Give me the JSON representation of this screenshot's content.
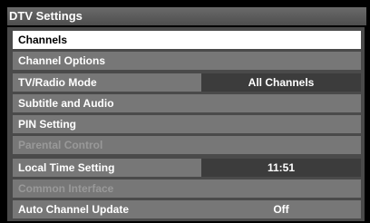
{
  "header": {
    "title": "DTV Settings"
  },
  "menu": {
    "items": [
      {
        "label": "Channels",
        "value": null,
        "state": "selected"
      },
      {
        "label": "Channel Options",
        "value": null,
        "state": "normal"
      },
      {
        "label": "TV/Radio Mode",
        "value": "All Channels",
        "state": "normal"
      },
      {
        "label": "Subtitle and Audio",
        "value": null,
        "state": "normal"
      },
      {
        "label": "PIN Setting",
        "value": null,
        "state": "normal"
      },
      {
        "label": "Parental Control",
        "value": null,
        "state": "disabled"
      },
      {
        "label": "Local Time Setting",
        "value": "11:51",
        "state": "normal"
      },
      {
        "label": "Common Interface",
        "value": null,
        "state": "disabled"
      },
      {
        "label": "Auto Channel Update",
        "value": "Off",
        "state": "normal"
      }
    ]
  },
  "colors": {
    "selected_bg": "#ffffff",
    "row_bg": "#777777",
    "panel_bg": "#4a4a4a",
    "value_box_bg": "#3c3c3c",
    "disabled_text": "#999999"
  }
}
